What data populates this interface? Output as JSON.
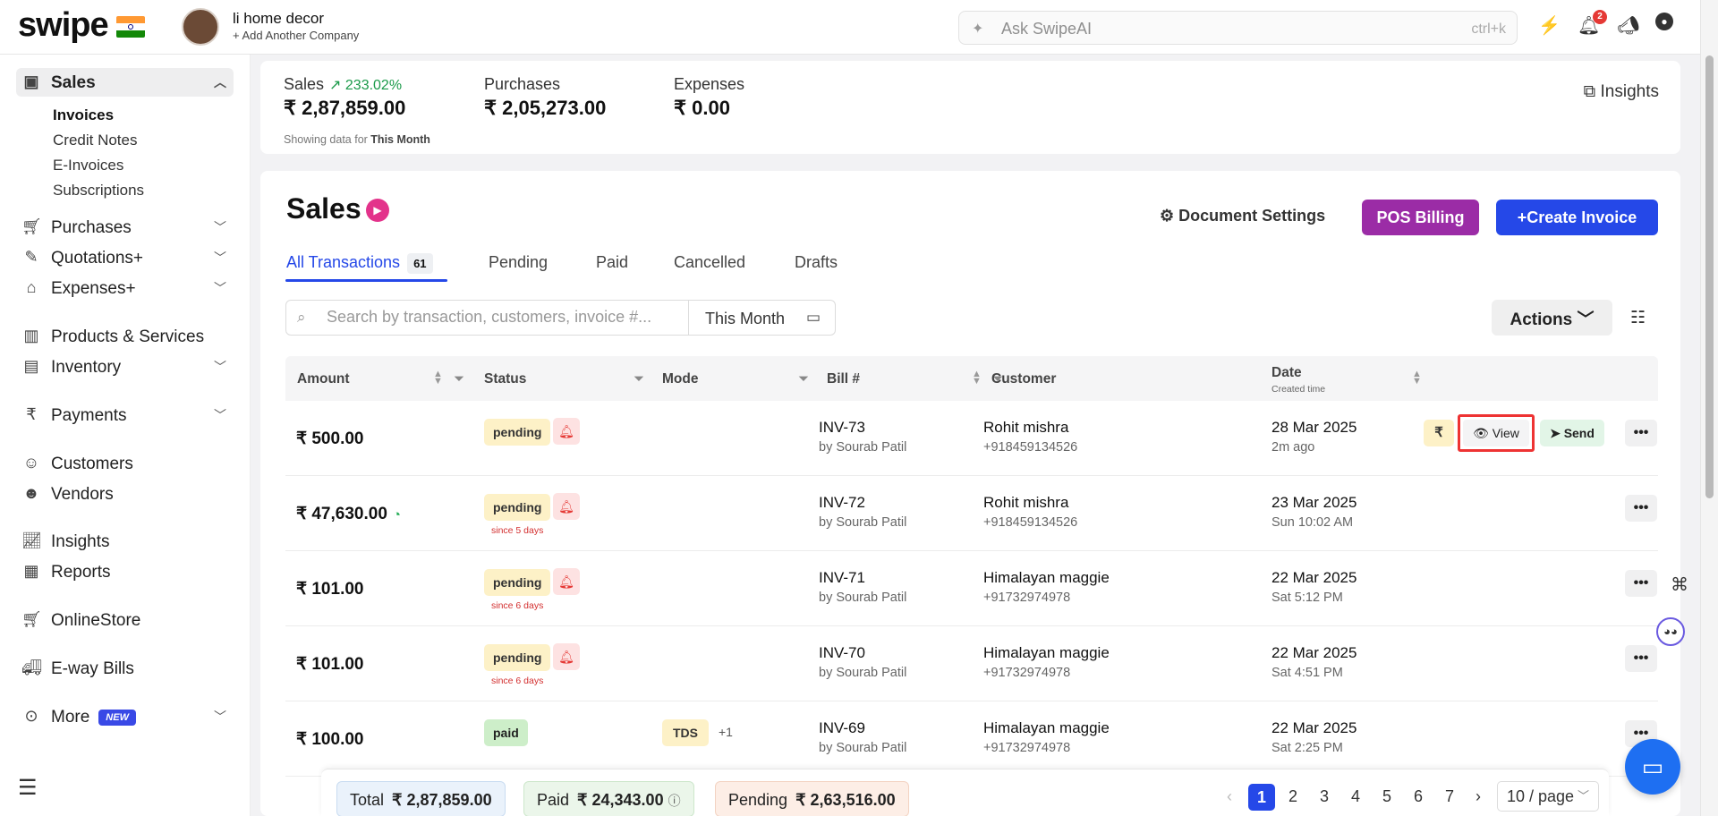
{
  "app": {
    "logo": "swipe",
    "flag_icon": "india-flag-icon",
    "company_name": "li home decor",
    "add_company": "Add Another Company",
    "search_placeholder": "Ask SwipeAI",
    "search_shortcut": "ctrl+k",
    "notification_count": "2"
  },
  "sidebar": {
    "sales": "Sales",
    "sub_items": [
      "Invoices",
      "Credit Notes",
      "E-Invoices",
      "Subscriptions"
    ],
    "purchases": "Purchases",
    "quotations": "Quotations+",
    "expenses": "Expenses+",
    "products": "Products & Services",
    "inventory": "Inventory",
    "payments": "Payments",
    "customers": "Customers",
    "vendors": "Vendors",
    "insights": "Insights",
    "reports": "Reports",
    "online_store": "OnlineStore",
    "eway_bills": "E-way Bills",
    "more": "More",
    "new_badge": "NEW"
  },
  "stats": {
    "sales_label": "Sales",
    "sales_growth": "233.02%",
    "sales_value": "₹ 2,87,859.00",
    "purchases_label": "Purchases",
    "purchases_value": "₹ 2,05,273.00",
    "expenses_label": "Expenses",
    "expenses_value": "₹ 0.00",
    "showing_prefix": "Showing data for",
    "showing_period": "This Month",
    "insights_link": "Insights"
  },
  "main": {
    "title": "Sales",
    "document_settings": "Document Settings",
    "pos_billing": "POS Billing",
    "create_invoice": "Create Invoice",
    "tabs": [
      {
        "label": "All Transactions",
        "count": "61"
      },
      {
        "label": "Pending"
      },
      {
        "label": "Paid"
      },
      {
        "label": "Cancelled"
      },
      {
        "label": "Drafts"
      }
    ],
    "search_placeholder": "Search by transaction, customers, invoice #...",
    "period": "This Month",
    "actions": "Actions"
  },
  "table": {
    "columns": {
      "amount": "Amount",
      "status": "Status",
      "mode": "Mode",
      "bill": "Bill #",
      "customer": "Customer",
      "date": "Date",
      "date_sub": "Created time"
    },
    "rows": [
      {
        "amount": "₹ 500.00",
        "status": "pending",
        "since": "",
        "mode": "",
        "mode_extra": "",
        "bill": "INV-73",
        "by": "by Sourab Patil",
        "customer": "Rohit mishra",
        "phone": "+918459134526",
        "date": "28 Mar 2025",
        "time": "2m ago"
      },
      {
        "amount": "₹ 47,630.00",
        "status": "pending",
        "since": "since 5 days",
        "mode": "",
        "mode_extra": "",
        "bill": "INV-72",
        "by": "by Sourab Patil",
        "customer": "Rohit mishra",
        "phone": "+918459134526",
        "date": "23 Mar 2025",
        "time": "Sun 10:02 AM"
      },
      {
        "amount": "₹ 101.00",
        "status": "pending",
        "since": "since 6 days",
        "mode": "",
        "mode_extra": "",
        "bill": "INV-71",
        "by": "by Sourab Patil",
        "customer": "Himalayan maggie",
        "phone": "+91732974978",
        "date": "22 Mar 2025",
        "time": "Sat 5:12 PM"
      },
      {
        "amount": "₹ 101.00",
        "status": "pending",
        "since": "since 6 days",
        "mode": "",
        "mode_extra": "",
        "bill": "INV-70",
        "by": "by Sourab Patil",
        "customer": "Himalayan maggie",
        "phone": "+91732974978",
        "date": "22 Mar 2025",
        "time": "Sat 4:51 PM"
      },
      {
        "amount": "₹ 100.00",
        "status": "paid",
        "since": "",
        "mode": "TDS",
        "mode_extra": "+1",
        "bill": "INV-69",
        "by": "by Sourab Patil",
        "customer": "Himalayan maggie",
        "phone": "+91732974978",
        "date": "22 Mar 2025",
        "time": "Sat 2:25 PM"
      }
    ],
    "row_actions": {
      "rupee": "₹",
      "view": "View",
      "send": "Send",
      "more": "•••"
    }
  },
  "footer": {
    "total_label": "Total",
    "total_value": "₹ 2,87,859.00",
    "paid_label": "Paid",
    "paid_value": "₹ 24,343.00",
    "pending_label": "Pending",
    "pending_value": "₹ 2,63,516.00",
    "pages": [
      "1",
      "2",
      "3",
      "4",
      "5",
      "6",
      "7"
    ],
    "per_page": "10 / page"
  },
  "colors": {
    "primary": "#2548e8",
    "pos": "#9b2ca6",
    "growth": "#1b9a4a",
    "pending_badge": "#fdf1c7",
    "paid_badge": "#cdeec9"
  }
}
